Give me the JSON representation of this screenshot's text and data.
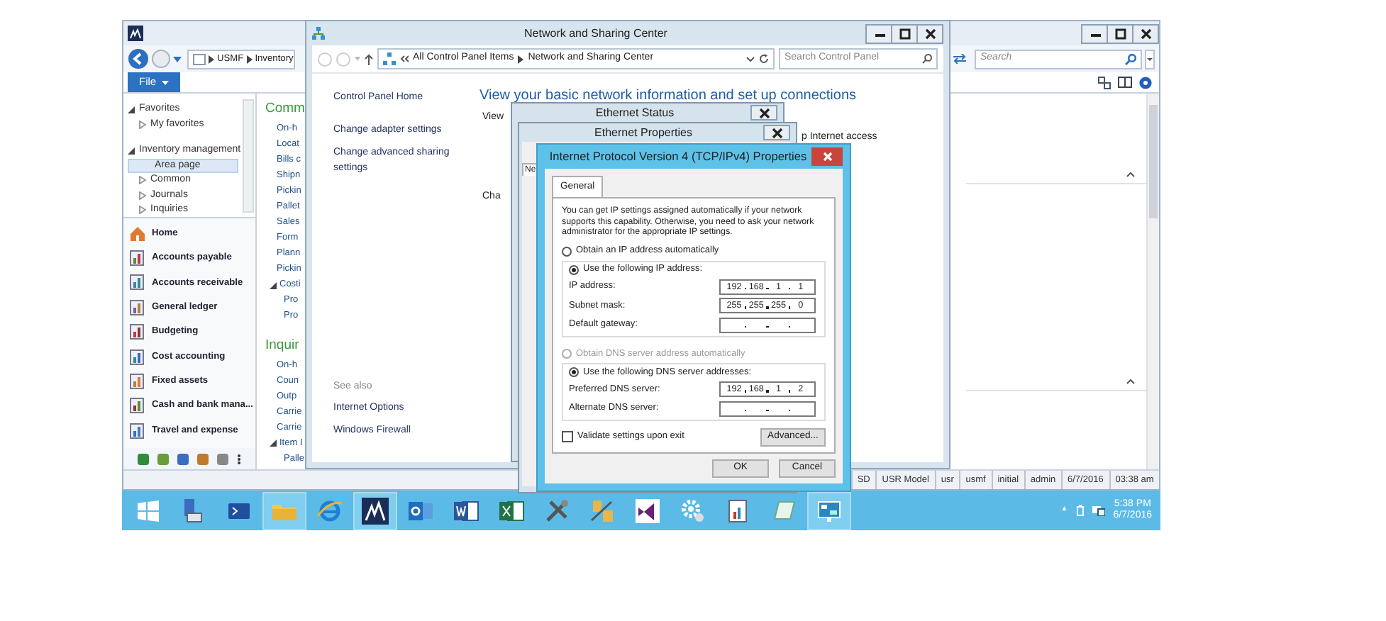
{
  "ax_window": {
    "breadcrumb": [
      "USMF",
      "Inventory"
    ],
    "search": {
      "placeholder": "Search"
    },
    "file_menu": "File",
    "nav_tree": [
      {
        "label": "Favorites",
        "expanded": true,
        "children": [
          {
            "label": "My favorites",
            "expanded": false,
            "selected": false
          }
        ]
      },
      {
        "label": "Inventory management",
        "expanded": true,
        "children": [
          {
            "label": "Area page",
            "selected": true
          },
          {
            "label": "Common",
            "expanded": false,
            "selected": false
          },
          {
            "label": "Journals",
            "expanded": false,
            "selected": false
          },
          {
            "label": "Inquiries",
            "expanded": false,
            "selected": false
          }
        ]
      }
    ],
    "modules": [
      "Home",
      "Accounts payable",
      "Accounts receivable",
      "General ledger",
      "Budgeting",
      "Cost accounting",
      "Fixed assets",
      "Cash and bank mana...",
      "Travel and expense"
    ],
    "sections": [
      {
        "title": "Comm",
        "links": [
          {
            "label": "On-h"
          },
          {
            "label": "Locat"
          },
          {
            "label": "Bills c"
          },
          {
            "label": "Shipn"
          },
          {
            "label": "Pickin"
          },
          {
            "label": "Pallet"
          },
          {
            "label": "Sales"
          },
          {
            "label": "Form"
          },
          {
            "label": "Plann"
          },
          {
            "label": "Pickin"
          },
          {
            "label": "Costi",
            "expanded": true,
            "children": [
              {
                "label": "Pro"
              },
              {
                "label": "Pro"
              }
            ]
          }
        ]
      },
      {
        "title": "Inquir",
        "links": [
          {
            "label": "On-h"
          },
          {
            "label": "Coun"
          },
          {
            "label": "Outp"
          },
          {
            "label": "Carrie"
          },
          {
            "label": "Carrie"
          },
          {
            "label": "Item I",
            "expanded": true,
            "children": [
              {
                "label": "Palle"
              }
            ]
          }
        ]
      }
    ],
    "status_bar": [
      "SD",
      "USR Model",
      "usr",
      "usmf",
      "initial",
      "admin",
      "6/7/2016",
      "03:38 am"
    ]
  },
  "nsc_window": {
    "title": "Network and Sharing Center",
    "breadcrumb": [
      "All Control Panel Items",
      "Network and Sharing Center"
    ],
    "search": {
      "placeholder": "Search Control Panel"
    },
    "tasks": [
      "Control Panel Home",
      "Change adapter settings",
      "Change advanced sharing settings"
    ],
    "see_also": {
      "heading": "See also",
      "links": [
        "Internet Options",
        "Windows Firewall"
      ]
    },
    "heading": "View your basic network information and set up connections",
    "partial_texts": [
      "View",
      "p Internet access",
      "Cha"
    ]
  },
  "ethernet_status": {
    "title": "Ethernet Status"
  },
  "ethernet_properties": {
    "title": "Ethernet Properties",
    "tab": "Ne"
  },
  "ipv4_dialog": {
    "title": "Internet Protocol Version 4 (TCP/IPv4) Properties",
    "tabs": [
      {
        "label": "General",
        "selected": true
      }
    ],
    "intro": "You can get IP settings assigned automatically if your network supports this capability. Otherwise, you need to ask your network administrator for the appropriate IP settings.",
    "ip_options": [
      {
        "label": "Obtain an IP address automatically",
        "selected": false
      },
      {
        "label": "Use the following IP address:",
        "selected": true
      }
    ],
    "ip_fields": [
      {
        "label": "IP address:",
        "octets": [
          "192",
          "168",
          "1",
          "1"
        ]
      },
      {
        "label": "Subnet mask:",
        "octets": [
          "255",
          "255",
          "255",
          "0"
        ]
      },
      {
        "label": "Default gateway:"
      }
    ],
    "dns_options": [
      {
        "label": "Obtain DNS server address automatically",
        "selected": false,
        "disabled": true
      },
      {
        "label": "Use the following DNS server addresses:",
        "selected": true,
        "disabled": false
      }
    ],
    "dns_fields": [
      {
        "label": "Preferred DNS server:",
        "octets": [
          "192",
          "168",
          "1",
          "2"
        ]
      },
      {
        "label": "Alternate DNS server:"
      }
    ],
    "validate": {
      "label": "Validate settings upon exit",
      "checked": false
    },
    "advanced_button": "Advanced...",
    "buttons": [
      "OK",
      "Cancel"
    ]
  },
  "taskbar": {
    "apps": [
      {
        "kind": "start",
        "active": false
      },
      {
        "kind": "server",
        "active": false
      },
      {
        "kind": "terminal",
        "active": false
      },
      {
        "kind": "folder",
        "active": true
      },
      {
        "kind": "browser",
        "active": false
      },
      {
        "kind": "ax",
        "active": true
      },
      {
        "kind": "mail",
        "active": false
      },
      {
        "kind": "word",
        "active": false
      },
      {
        "kind": "sheet",
        "active": false
      },
      {
        "kind": "tools",
        "active": false
      },
      {
        "kind": "nettool",
        "active": false
      },
      {
        "kind": "vs",
        "active": false
      },
      {
        "kind": "gear",
        "active": false
      },
      {
        "kind": "report",
        "active": false
      },
      {
        "kind": "notepad",
        "active": false
      },
      {
        "kind": "control",
        "active": true
      }
    ],
    "tray_toggle": "▲",
    "time": "5:38 PM",
    "date": "6/7/2016"
  }
}
